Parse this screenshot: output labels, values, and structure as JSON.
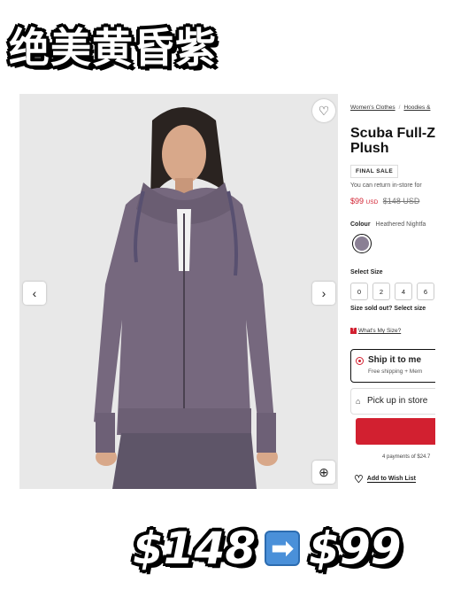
{
  "headline": "绝美黄昏紫",
  "gallery": {
    "prev_icon": "chevron-left-icon",
    "next_icon": "chevron-right-icon",
    "wishlist_icon": "heart-outline-icon",
    "zoom_icon": "zoom-in-icon"
  },
  "breadcrumb": [
    "Women's Clothes",
    "Hoodies &"
  ],
  "product": {
    "title": "Scuba Full-Z\nPlush",
    "badge": "FINAL SALE",
    "return_note": "You can return in-store for",
    "price": "$99",
    "currency": "USD",
    "original_price": "$148 USD",
    "colour_label": "Colour",
    "colour_value": "Heathered Nightfa",
    "swatch_color": "#8a7f94",
    "select_size_label": "Select Size",
    "sizes": [
      "0",
      "2",
      "4",
      "6"
    ],
    "sold_out_text": "Size sold out? Select size",
    "whats_my_size": "What's My Size?"
  },
  "delivery": {
    "ship_label": "Ship it to me",
    "ship_sub": "Free shipping + Mem",
    "pickup_label": "Pick up in store",
    "accent_color": "#d22030"
  },
  "payments_text": "4 payments of $24.7",
  "wishlist_text": "Add to Wish List",
  "bottom": {
    "old_price": "$148",
    "arrow": "➡",
    "new_price": "$99"
  }
}
